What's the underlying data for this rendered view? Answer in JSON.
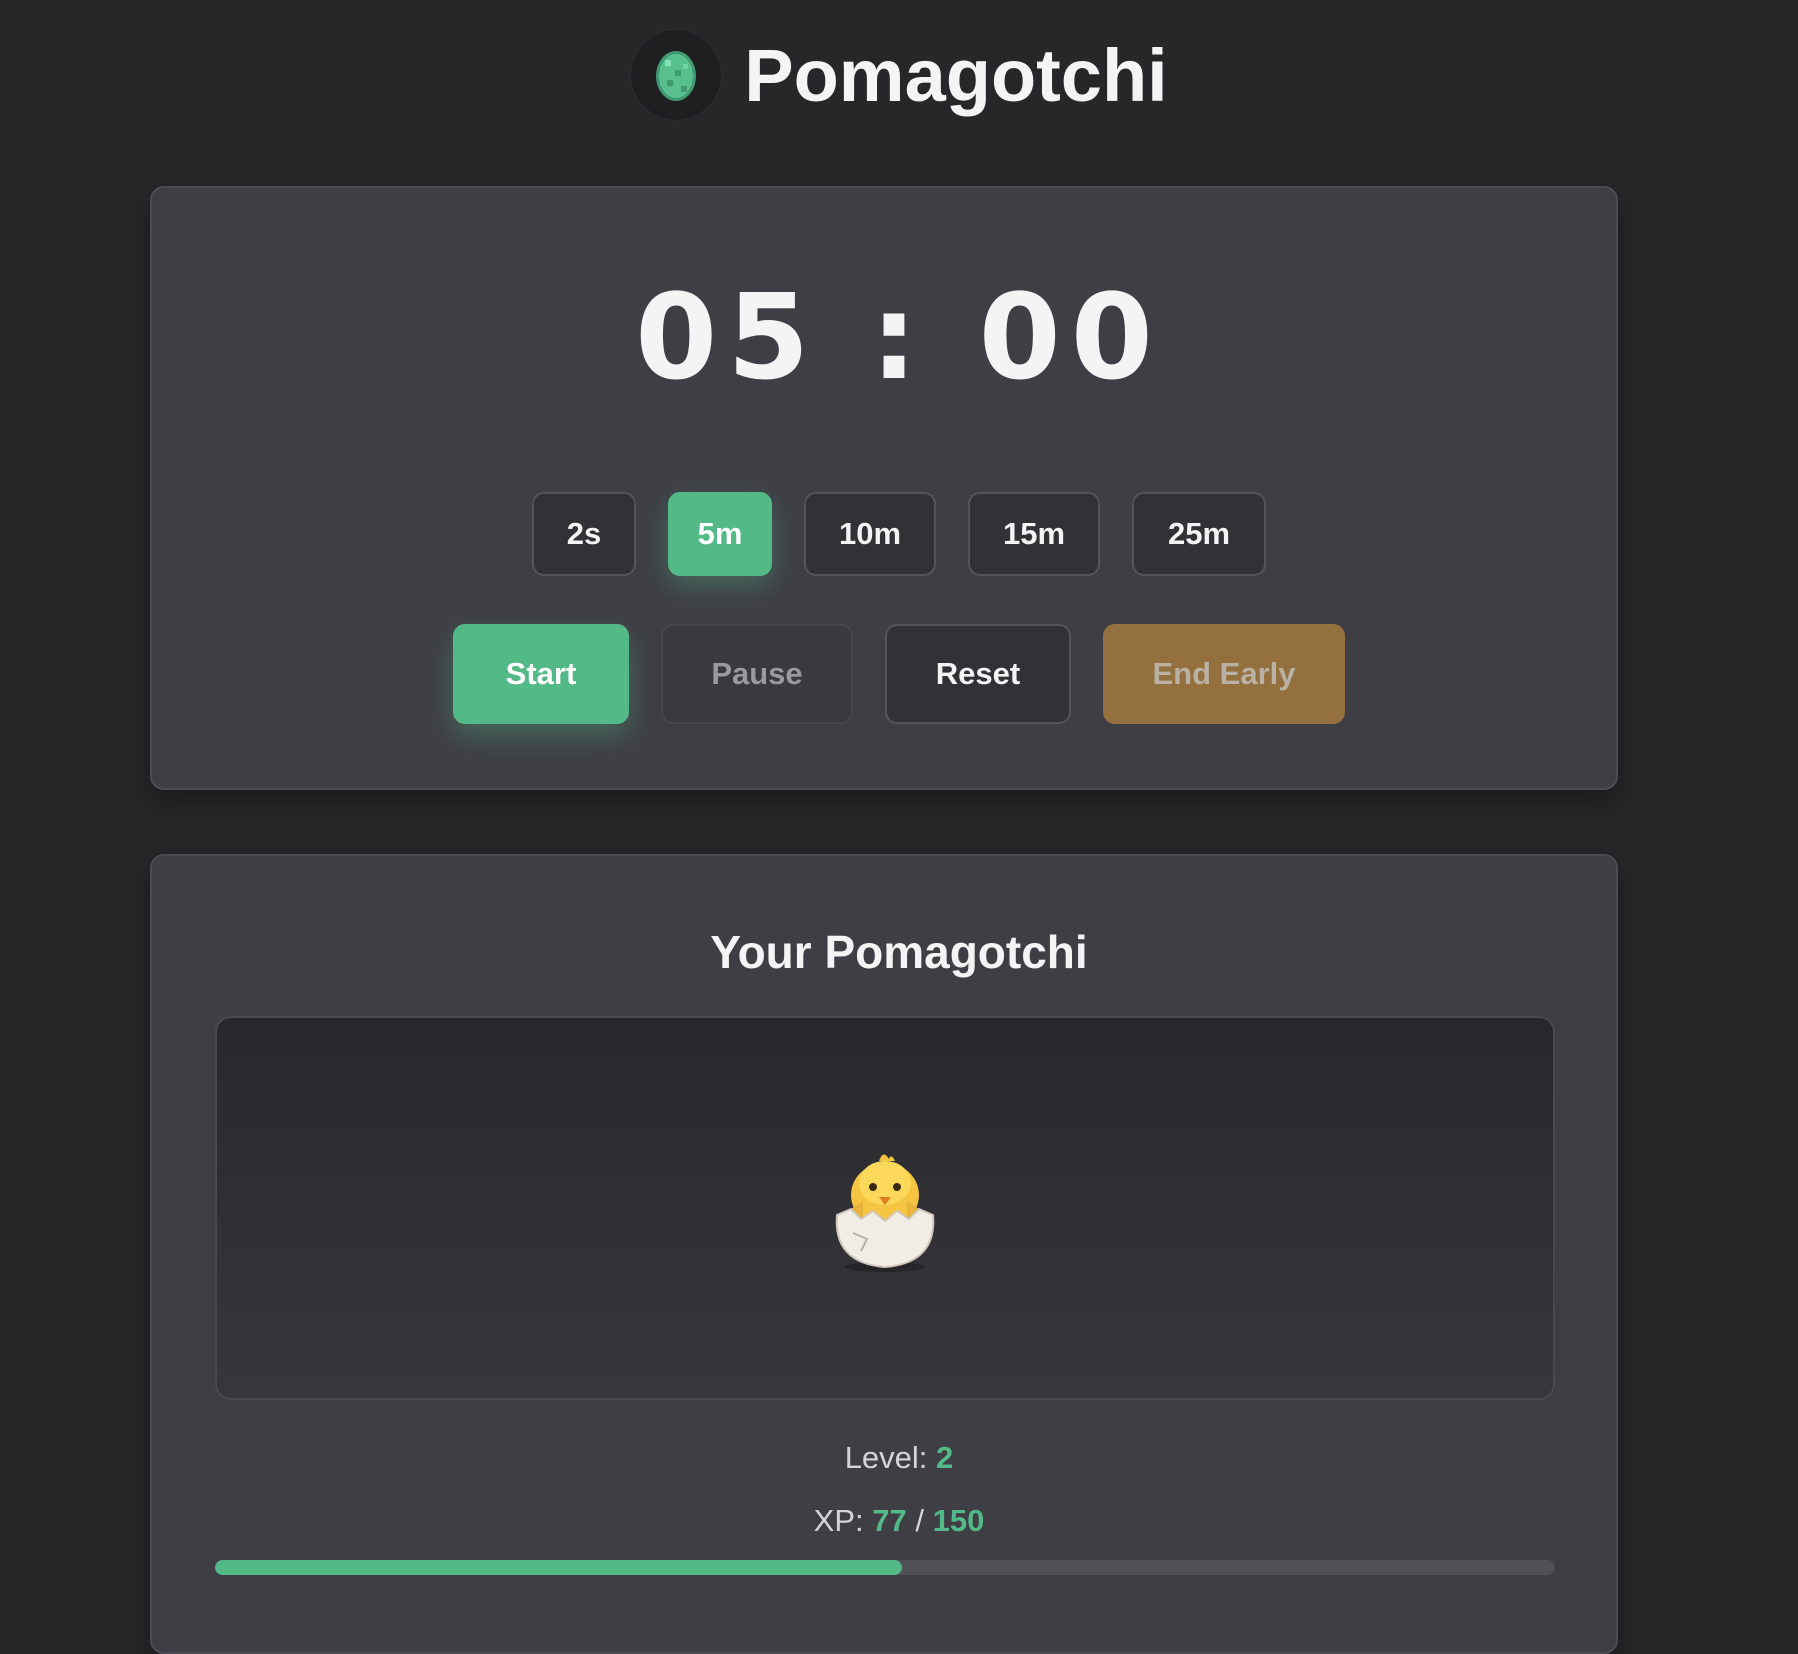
{
  "header": {
    "logo_icon": "green-egg-icon",
    "title": "Pomagotchi"
  },
  "timer": {
    "display": "05 : 00",
    "presets": [
      {
        "label": "2s",
        "active": false
      },
      {
        "label": "5m",
        "active": true
      },
      {
        "label": "10m",
        "active": false
      },
      {
        "label": "15m",
        "active": false
      },
      {
        "label": "25m",
        "active": false
      }
    ],
    "controls": {
      "start_label": "Start",
      "pause_label": "Pause",
      "reset_label": "Reset",
      "end_early_label": "End Early"
    }
  },
  "pet": {
    "title": "Your Pomagotchi",
    "sprite": "🐣",
    "sprite_icon": "hatching-chick-icon",
    "level_label": "Level:",
    "level_value": "2",
    "xp_label": "XP:",
    "xp_current": "77",
    "xp_separator": "/",
    "xp_max": "150",
    "xp_progress": 0.513
  },
  "colors": {
    "background": "#27272a",
    "card": "#3f3e45",
    "accent": "#53b987",
    "end_early": "#94703f"
  }
}
